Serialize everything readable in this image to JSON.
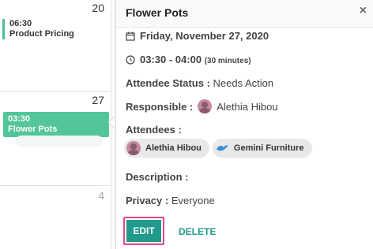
{
  "calendar": {
    "days": [
      {
        "number": "20"
      },
      {
        "number": "27"
      },
      {
        "number": "4"
      }
    ],
    "events": [
      {
        "time": "06:30",
        "title": "Product Pricing"
      },
      {
        "time": "03:30",
        "title": "Flower Pots"
      }
    ]
  },
  "popover": {
    "title": "Flower Pots",
    "close": "×",
    "date": "Friday, November 27, 2020",
    "time": "03:30 - 04:00",
    "duration": "(30 minutes)",
    "attendee_status_label": "Attendee Status :",
    "attendee_status_value": "Needs Action",
    "responsible_label": "Responsible :",
    "responsible_value": "Alethia Hibou",
    "attendees_label": "Attendees :",
    "attendees": [
      {
        "name": "Alethia Hibou"
      },
      {
        "name": "Gemini Furniture"
      }
    ],
    "description_label": "Description :",
    "privacy_label": "Privacy :",
    "privacy_value": "Everyone",
    "edit_label": "EDIT",
    "delete_label": "DELETE"
  },
  "colors": {
    "event_green": "#52c59b",
    "primary_teal": "#1f9a8d",
    "highlight_pink": "#e0468a"
  }
}
